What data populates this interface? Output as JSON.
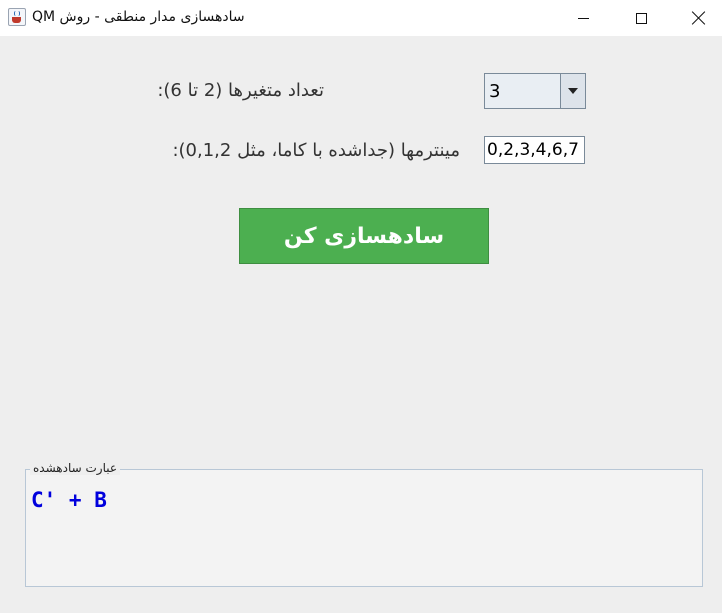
{
  "window": {
    "title": "سادهسازی مدار منطقی - روش QM",
    "min_symbol": "",
    "max_symbol": "",
    "close_symbol": ""
  },
  "form": {
    "variables_label": "تعداد متغیرها (2 تا 6):",
    "variables_value": "3",
    "minterms_label": "مینترمها (جداشده با کاما، مثل 0,1,2):",
    "minterms_value": "0,2,3,4,6,7",
    "submit_label": "سادهسازی کن"
  },
  "result": {
    "legend": "عبارت سادهشده",
    "expression": "C' + B"
  },
  "icons": {
    "app": "java-cup-icon",
    "dropdown": "chevron-down-icon"
  },
  "colors": {
    "button_bg": "#4caf50",
    "result_text": "#0000dd"
  }
}
